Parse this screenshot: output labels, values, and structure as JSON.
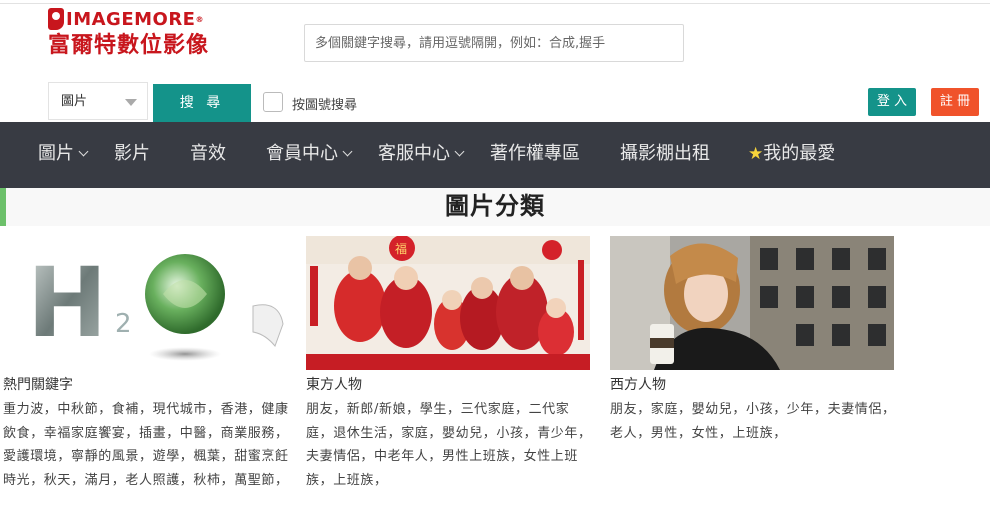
{
  "logo": {
    "en": "IMAGEMORE",
    "reg": "®",
    "cn": "富爾特數位影像"
  },
  "search": {
    "placeholder": "多個關鍵字搜尋，請用逗號隔開，例如：合成,握手",
    "select_value": "圖片",
    "button_label": "搜 尋",
    "checkbox_label": "按圖號搜尋"
  },
  "auth": {
    "login_label": "登 入",
    "register_label": "註 冊"
  },
  "nav": {
    "items": [
      {
        "label": "圖片"
      },
      {
        "label": "影片"
      },
      {
        "label": "音效"
      },
      {
        "label": "會員中心"
      },
      {
        "label": "客服中心"
      },
      {
        "label": "著作權專區"
      },
      {
        "label": "攝影棚出租"
      },
      {
        "label": "我的最愛",
        "icon": "star-icon"
      }
    ]
  },
  "section": {
    "title": "圖片分類"
  },
  "cards": [
    {
      "title": "熱門關鍵字",
      "tags": "重力波，中秋節，食補，現代城市，香港，健康飲食，幸福家庭饗宴，插畫，中醫，商業服務，愛護環境，寧靜的風景，遊學，楓葉，甜蜜烹飪時光，秋天，滿月，老人照護，秋柿，萬聖節，",
      "image_text": "H",
      "image_sub": "2"
    },
    {
      "title": "東方人物",
      "tags": "朋友，新郎/新娘，學生，三代家庭，二代家庭，退休生活，家庭，嬰幼兒，小孩，青少年，夫妻情侶，中老年人，男性上班族，女性上班族，上班族，",
      "image_text": "福"
    },
    {
      "title": "西方人物",
      "tags": "朋友，家庭，嬰幼兒，小孩，少年，夫妻情侶，老人，男性，女性，上班族，"
    }
  ],
  "colors": {
    "teal": "#14938a",
    "orange": "#f0532b",
    "nav_bg": "#383b43",
    "brand_red": "#c8161d",
    "accent_green": "#6cc06a"
  }
}
